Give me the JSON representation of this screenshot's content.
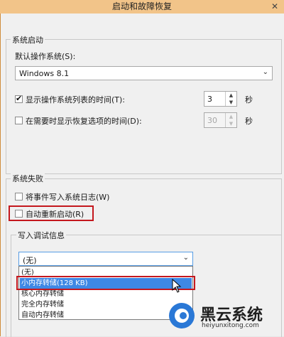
{
  "window": {
    "title": "启动和故障恢复",
    "close_glyph": "✕"
  },
  "system_startup": {
    "group_label": "系统启动",
    "default_os_label": "默认操作系统(S):",
    "default_os_value": "Windows 8.1",
    "show_os_list": {
      "label": "显示操作系统列表的时间(T):",
      "checked": true,
      "value": "3",
      "unit": "秒"
    },
    "show_recovery": {
      "label": "在需要时显示恢复选项的时间(D):",
      "checked": false,
      "value": "30",
      "unit": "秒"
    }
  },
  "system_failure": {
    "group_label": "系统失败",
    "write_event": {
      "label": "将事件写入系统日志(W)",
      "checked": false
    },
    "auto_restart": {
      "label": "自动重新启动(R)",
      "checked": false
    },
    "debug_group_label": "写入调试信息",
    "debug_selected": "(无)",
    "debug_options": [
      "(无)",
      "小内存转储(128 KB)",
      "核心内存转储",
      "完全内存转储",
      "自动内存转储"
    ],
    "highlighted_index": 1
  },
  "watermark": {
    "name": "黑云系统",
    "url": "heiyunxitong.com"
  },
  "colors": {
    "accent_title": "#f2c489",
    "highlight": "#3e88e5",
    "annotation_red": "#c4171d"
  }
}
